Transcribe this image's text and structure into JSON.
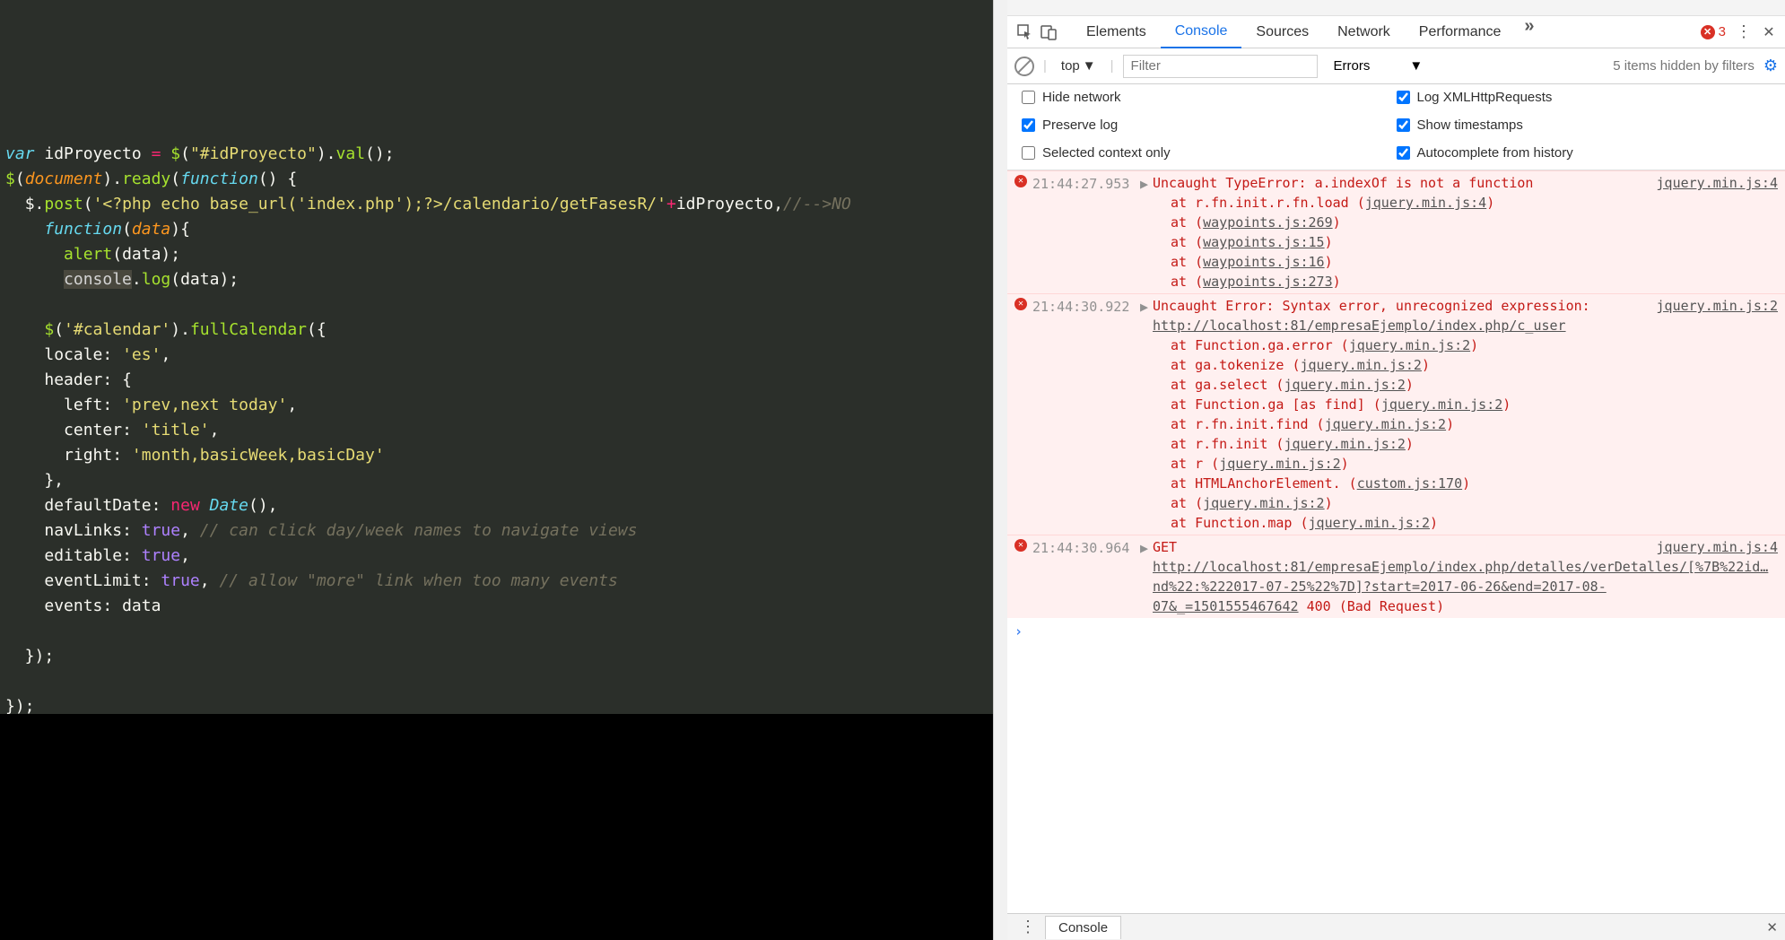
{
  "editor": {
    "lines": [
      [
        [
          "",
          ""
        ]
      ],
      [
        [
          "kw-var",
          "var"
        ],
        [
          "pn",
          " "
        ],
        [
          "id",
          "idProyecto"
        ],
        [
          "pn",
          " "
        ],
        [
          "op",
          "="
        ],
        [
          "pn",
          " "
        ],
        [
          "fn",
          "$"
        ],
        [
          "pn",
          "("
        ],
        [
          "str",
          "\"#idProyecto\""
        ],
        [
          "pn",
          ")."
        ],
        [
          "fn",
          "val"
        ],
        [
          "pn",
          "();"
        ]
      ],
      [
        [
          "fn",
          "$"
        ],
        [
          "pn",
          "("
        ],
        [
          "arg",
          "document"
        ],
        [
          "pn",
          ")."
        ],
        [
          "fn",
          "ready"
        ],
        [
          "pn",
          "("
        ],
        [
          "kw-decl",
          "function"
        ],
        [
          "pn",
          "() {"
        ]
      ],
      [
        [
          "pn",
          "  "
        ],
        [
          "id",
          "$"
        ],
        [
          "pn",
          "."
        ],
        [
          "fn",
          "post"
        ],
        [
          "pn",
          "("
        ],
        [
          "str",
          "'<?php echo base_url('index.php');?>/calendario/getFasesR/'"
        ],
        [
          "op",
          "+"
        ],
        [
          "id",
          "idProyecto"
        ],
        [
          "pn",
          ","
        ],
        [
          "cm",
          "//-->NO"
        ]
      ],
      [
        [
          "pn",
          "    "
        ],
        [
          "kw-decl",
          "function"
        ],
        [
          "pn",
          "("
        ],
        [
          "arg",
          "data"
        ],
        [
          "pn",
          "){"
        ]
      ],
      [
        [
          "pn",
          "      "
        ],
        [
          "fn",
          "alert"
        ],
        [
          "pn",
          "("
        ],
        [
          "id",
          "data"
        ],
        [
          "pn",
          ");"
        ]
      ],
      [
        [
          "pn",
          "      "
        ],
        [
          "sel",
          "console"
        ],
        [
          "pn",
          "."
        ],
        [
          "fn",
          "log"
        ],
        [
          "pn",
          "("
        ],
        [
          "id",
          "data"
        ],
        [
          "pn",
          ");"
        ]
      ],
      [
        [
          "",
          ""
        ]
      ],
      [
        [
          "pn",
          "    "
        ],
        [
          "fn",
          "$"
        ],
        [
          "pn",
          "("
        ],
        [
          "str",
          "'#calendar'"
        ],
        [
          "pn",
          ")."
        ],
        [
          "fn",
          "fullCalendar"
        ],
        [
          "pn",
          "({"
        ]
      ],
      [
        [
          "pn",
          "    "
        ],
        [
          "id",
          "locale"
        ],
        [
          "pn",
          ": "
        ],
        [
          "str",
          "'es'"
        ],
        [
          "pn",
          ","
        ]
      ],
      [
        [
          "pn",
          "    "
        ],
        [
          "id",
          "header"
        ],
        [
          "pn",
          ": {"
        ]
      ],
      [
        [
          "pn",
          "      "
        ],
        [
          "id",
          "left"
        ],
        [
          "pn",
          ": "
        ],
        [
          "str",
          "'prev,next today'"
        ],
        [
          "pn",
          ","
        ]
      ],
      [
        [
          "pn",
          "      "
        ],
        [
          "id",
          "center"
        ],
        [
          "pn",
          ": "
        ],
        [
          "str",
          "'title'"
        ],
        [
          "pn",
          ","
        ]
      ],
      [
        [
          "pn",
          "      "
        ],
        [
          "id",
          "right"
        ],
        [
          "pn",
          ": "
        ],
        [
          "str",
          "'month,basicWeek,basicDay'"
        ]
      ],
      [
        [
          "pn",
          "    },"
        ]
      ],
      [
        [
          "pn",
          "    "
        ],
        [
          "id",
          "defaultDate"
        ],
        [
          "pn",
          ": "
        ],
        [
          "kw",
          "new"
        ],
        [
          "pn",
          " "
        ],
        [
          "ty",
          "Date"
        ],
        [
          "pn",
          "(),"
        ]
      ],
      [
        [
          "pn",
          "    "
        ],
        [
          "id",
          "navLinks"
        ],
        [
          "pn",
          ": "
        ],
        [
          "bool",
          "true"
        ],
        [
          "pn",
          ", "
        ],
        [
          "cm",
          "// can click day/week names to navigate views"
        ]
      ],
      [
        [
          "pn",
          "    "
        ],
        [
          "id",
          "editable"
        ],
        [
          "pn",
          ": "
        ],
        [
          "bool",
          "true"
        ],
        [
          "pn",
          ","
        ]
      ],
      [
        [
          "pn",
          "    "
        ],
        [
          "id",
          "eventLimit"
        ],
        [
          "pn",
          ": "
        ],
        [
          "bool",
          "true"
        ],
        [
          "pn",
          ", "
        ],
        [
          "cm",
          "// allow \"more\" link when too many events"
        ]
      ],
      [
        [
          "pn",
          "    "
        ],
        [
          "id",
          "events"
        ],
        [
          "pn",
          ": "
        ],
        [
          "id",
          "data"
        ]
      ],
      [
        [
          "",
          ""
        ]
      ],
      [
        [
          "pn",
          "  });"
        ]
      ],
      [
        [
          "",
          ""
        ]
      ],
      [
        [
          "pn",
          "});"
        ]
      ]
    ]
  },
  "devtools": {
    "tabs": [
      "Elements",
      "Console",
      "Sources",
      "Network",
      "Performance"
    ],
    "active_tab": "Console",
    "more_glyph": "»",
    "error_count": "3",
    "menu_glyph": "⋮",
    "close_glyph": "✕",
    "filterbar": {
      "context": "top",
      "filter_placeholder": "Filter",
      "level": "Errors",
      "hidden_msg": "5 items hidden by filters"
    },
    "options": {
      "hide_network": {
        "label": "Hide network",
        "checked": false
      },
      "log_xhr": {
        "label": "Log XMLHttpRequests",
        "checked": true
      },
      "preserve_log": {
        "label": "Preserve log",
        "checked": true
      },
      "show_timestamps": {
        "label": "Show timestamps",
        "checked": true
      },
      "selected_context": {
        "label": "Selected context only",
        "checked": false
      },
      "autocomplete": {
        "label": "Autocomplete from history",
        "checked": true
      }
    },
    "logs": [
      {
        "ts": "21:44:27.953",
        "msg": "Uncaught TypeError: a.indexOf is not a function",
        "src": "jquery.min.js:4",
        "stack": [
          {
            "at": "at r.fn.init.r.fn.load ",
            "loc": "jquery.min.js:4"
          },
          {
            "at": "at ",
            "loc": "waypoints.js:269"
          },
          {
            "at": "at ",
            "loc": "waypoints.js:15"
          },
          {
            "at": "at ",
            "loc": "waypoints.js:16"
          },
          {
            "at": "at ",
            "loc": "waypoints.js:273"
          }
        ]
      },
      {
        "ts": "21:44:30.922",
        "msg": "Uncaught Error: Syntax error, unrecognized expression: ",
        "url": "http://localhost:81/empresaEjemplo/index.php/c_user",
        "src": "jquery.min.js:2",
        "stack": [
          {
            "at": "at Function.ga.error ",
            "loc": "jquery.min.js:2"
          },
          {
            "at": "at ga.tokenize ",
            "loc": "jquery.min.js:2"
          },
          {
            "at": "at ga.select ",
            "loc": "jquery.min.js:2"
          },
          {
            "at": "at Function.ga [as find] ",
            "loc": "jquery.min.js:2"
          },
          {
            "at": "at r.fn.init.find ",
            "loc": "jquery.min.js:2"
          },
          {
            "at": "at r.fn.init ",
            "loc": "jquery.min.js:2"
          },
          {
            "at": "at r ",
            "loc": "jquery.min.js:2"
          },
          {
            "at": "at HTMLAnchorElement.<anonymous> ",
            "loc": "custom.js:170"
          },
          {
            "at": "at ",
            "loc": "jquery.min.js:2"
          },
          {
            "at": "at Function.map ",
            "loc": "jquery.min.js:2"
          }
        ]
      },
      {
        "ts": "21:44:30.964",
        "method": "GET",
        "url": "http://localhost:81/empresaEjemplo/index.php/detalles/verDetalles/[%7B%22id…nd%22:%222017-07-25%22%7D]?start=2017-06-26&end=2017-08-07&_=1501555467642",
        "status": "400 (Bad Request)",
        "src": "jquery.min.js:4"
      }
    ],
    "footer_tab": "Console"
  }
}
